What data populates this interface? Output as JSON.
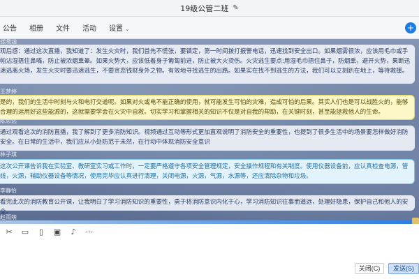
{
  "window": {
    "title": "19级公管二班"
  },
  "tabs": [
    {
      "label": "公告"
    },
    {
      "label": "相册"
    },
    {
      "label": "文件"
    },
    {
      "label": "活动"
    },
    {
      "label": "设置"
    }
  ],
  "messages": [
    {
      "sender": "张晓涵",
      "text": "观后感：通过这次直播，我知道了：发生火灾时，我们首先不慌张，要镇定，第一时间拨打报警电话，迅速找到安全出口。如果烟雾很浓，应该用毛巾或手帕沾湿捂住鼻嘴，防止被浓烟熏晕。如果火势大，应该低着身子匍匐前进，防止被大火烫伤。火灾逃生要点:用湿毛巾捂住鼻子，防烟熏，避开火势，果断迅速逃离火场，发生火灾时要迅速逃生，不要贪恋钱财身外之物。有效地寻找逃生的出路。如果实在找不到逃生的方法，我们可以立刻趴在地上，等待救援。",
      "style": "plain"
    },
    {
      "sender": "王梦婷",
      "text": "是的，我们的生活中时刻与火和电打交道呢。如果对火或电不能正确的使用，就可能发生可怕的灾难，造成可怕的后果。其实人们也是可以战胜火的，能够合理的运用好这些能源的，这就需要学会在火灾中自救。切实学习和掌握相关的知识不仅是对自我的帮助，在关键时刻，甚至能拯救他人的生命。",
      "style": "yellow"
    },
    {
      "sender": "陈思远",
      "text": "通过观看这次的消防直播，我了解到了更多消防知识。视频通过互动等形式更加直观说明了消防安全的重要性，也提到了很多生活中的场景要怎样做好消防安全。在日常的生活中，我们应从小处防范于未然，在行动中体现消防安全意识",
      "style": "plain"
    },
    {
      "sender": "林子琪",
      "text": "这次公开课告诉我在实验室、教研室实习或工作时，一定要严格遵守各项安全管理规定，安全操作规程和有关制度。使用仪器设备前，应认真检查电源，管线，火源，辅助仪器设备等情况，使用完毕应认真进行清理，关闭电源，火源，气源，水源等，还应清除杂物和垃圾。",
      "style": "blue"
    },
    {
      "sender": "李静怡",
      "text": "看完此次的消防教育公开课，让我明白了学习消防知识的重要性，勇于将消防意识内化于心，学习消防知识往事而道远，处理好隐患，保护自己和他人的安全。",
      "style": "plain"
    },
    {
      "sender": "赵雨萌",
      "text": "",
      "style": "plain"
    }
  ],
  "input": {
    "value": ""
  },
  "buttons": {
    "close": "关闭(C)",
    "send": "发送(S)"
  }
}
